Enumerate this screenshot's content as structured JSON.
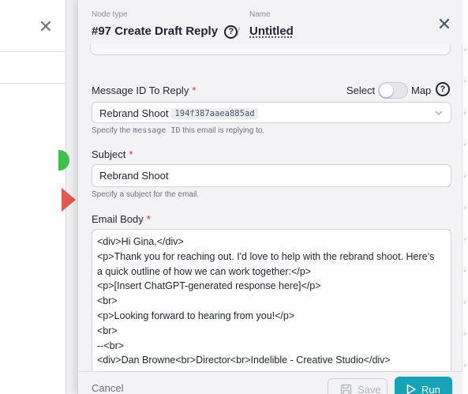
{
  "header": {
    "node_type_label": "Node type",
    "node_title": "#97 Create Draft Reply",
    "name_label": "Name",
    "name_value": "Untitled",
    "separator": "/"
  },
  "message_id": {
    "label": "Message ID To Reply",
    "required_mark": "*",
    "select_label": "Select",
    "map_label": "Map",
    "mode": "select",
    "selected_text": "Rebrand Shoot",
    "selected_id": "194f387aaea885ad",
    "help_prefix": "Specify the",
    "help_code": "message ID",
    "help_suffix": "this email is replying to."
  },
  "subject": {
    "label": "Subject",
    "required_mark": "*",
    "value": "Rebrand Shoot",
    "help": "Specify a subject for the email."
  },
  "email_body": {
    "label": "Email Body",
    "required_mark": "*",
    "lines": [
      "<div>Hi Gina,</div>",
      "<p>Thank you for reaching out. I'd love to help with the rebrand shoot. Here's",
      "a quick outline of how we can work together:</p>",
      "<p>[Insert ChatGPT-generated response here]</p>",
      "<br>",
      "<p>Looking forward to hearing from you!</p>",
      "<br>",
      "--<br>",
      "<div>Dan Browne<br>Director<br>Indelible - Creative Studio</div>"
    ]
  },
  "footer": {
    "cancel_label": "Cancel",
    "save_label": "Save",
    "run_label": "Run"
  },
  "colors": {
    "accent": "#17a2b8",
    "required": "#d9303a",
    "background": "#f3f3f5"
  },
  "icons": [
    "close-icon",
    "help-icon",
    "chevron-down-icon",
    "save-icon",
    "play-icon"
  ]
}
